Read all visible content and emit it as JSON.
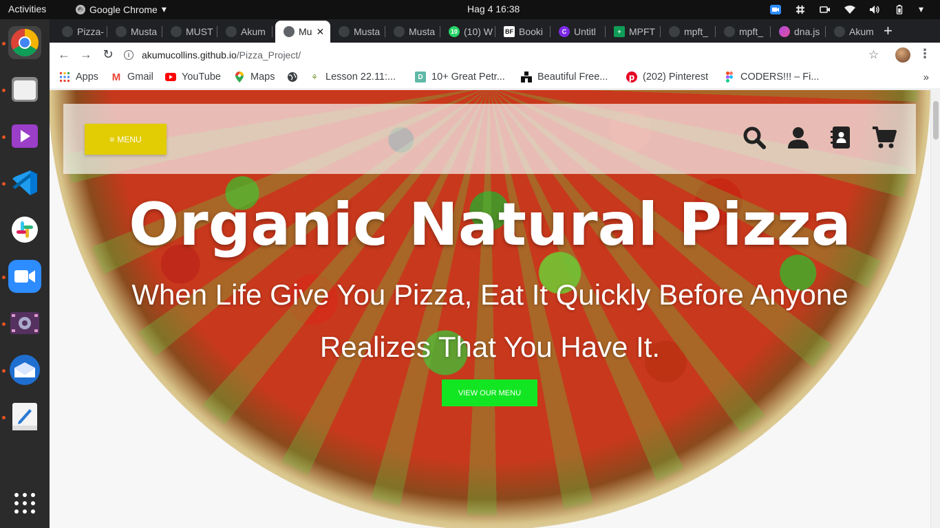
{
  "topbar": {
    "activities": "Activities",
    "app_name": "Google Chrome",
    "clock": "Hag 4  16:38"
  },
  "dock": {
    "apps": [
      "chrome-icon",
      "files-icon",
      "video-player-icon",
      "vscode-icon",
      "slack-icon",
      "zoom-icon",
      "screen-recorder-icon",
      "thunderbird-icon",
      "text-editor-icon",
      "show-apps-icon"
    ]
  },
  "tabs": [
    {
      "label": "Pizza-"
    },
    {
      "label": "Musta"
    },
    {
      "label": "MUST"
    },
    {
      "label": "Akum"
    },
    {
      "label": "Mu"
    },
    {
      "label": "Musta"
    },
    {
      "label": "Musta"
    },
    {
      "label": "(10) W"
    },
    {
      "label": "Booki"
    },
    {
      "label": "Untitl"
    },
    {
      "label": "MPFT"
    },
    {
      "label": "mpft_"
    },
    {
      "label": "mpft_"
    },
    {
      "label": "dna.js"
    },
    {
      "label": "Akum"
    }
  ],
  "tab_badges": {
    "whatsapp": "10",
    "bookmark_bf": "BF",
    "canva": "C",
    "sheets": "+"
  },
  "omnibox": {
    "host": "akumucollins.github.io",
    "path": "/Pizza_Project/"
  },
  "bookmarks": [
    {
      "label": "Apps"
    },
    {
      "label": "Gmail"
    },
    {
      "label": "YouTube"
    },
    {
      "label": "Maps"
    },
    {
      "label": ""
    },
    {
      "label": "Lesson 22.11:..."
    },
    {
      "label": "10+ Great Petr..."
    },
    {
      "label": "Beautiful Free..."
    },
    {
      "label": "(202) Pinterest"
    },
    {
      "label": "CODERS!!! – Fi..."
    }
  ],
  "page": {
    "menu_label": "MENU",
    "hero_title": "Organic Natural Pizza",
    "hero_subtitle": "When Life Give You Pizza, Eat It Quickly Before Anyone Realizes That You Have It.",
    "cta_label": "VIEW OUR MENU",
    "colors": {
      "menu_button": "#e2cc04",
      "cta_button": "#12e622",
      "header_icons": "#222222"
    }
  }
}
